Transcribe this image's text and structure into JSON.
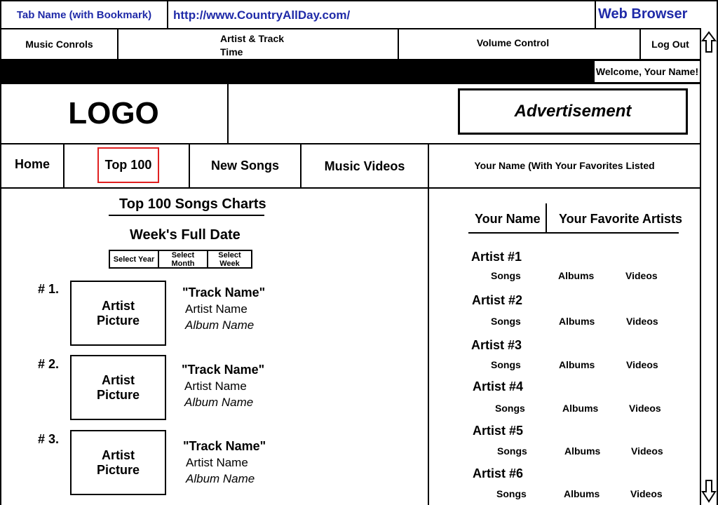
{
  "browser": {
    "tab_name": "Tab Name (with Bookmark)",
    "url": "http://www.CountryAllDay.com/",
    "title": "Web Browser"
  },
  "player": {
    "music_controls": "Music Conrols",
    "artist_track_line1": "Artist & Track",
    "artist_track_line2": "Time",
    "volume_control": "Volume Control",
    "log_out": "Log Out"
  },
  "welcome": "Welcome, Your Name!",
  "header": {
    "logo": "LOGO",
    "advertisement": "Advertisement"
  },
  "nav": {
    "home": "Home",
    "top100": "Top 100",
    "new_songs": "New Songs",
    "music_videos": "Music Videos",
    "favorites": "Your Name (With Your Favorites Listed"
  },
  "charts": {
    "title": "Top 100 Songs Charts",
    "date": "Week's Full Date",
    "select_year": "Select Year",
    "select_month": "Select Month",
    "select_week": "Select Week",
    "entries": [
      {
        "rank": "# 1.",
        "pic_line1": "Artist",
        "pic_line2": "Picture",
        "track": "\"Track Name\"",
        "artist": "Artist Name",
        "album": "Album Name"
      },
      {
        "rank": "# 2.",
        "pic_line1": "Artist",
        "pic_line2": "Picture",
        "track": "\"Track Name\"",
        "artist": "Artist Name",
        "album": "Album Name"
      },
      {
        "rank": "# 3.",
        "pic_line1": "Artist",
        "pic_line2": "Picture",
        "track": "\"Track Name\"",
        "artist": "Artist Name",
        "album": "Album Name"
      }
    ]
  },
  "favorites": {
    "your_name": "Your Name",
    "your_favorite_artists": "Your Favorite Artists",
    "artists": [
      {
        "name": "Artist #1",
        "songs": "Songs",
        "albums": "Albums",
        "videos": "Videos"
      },
      {
        "name": "Artist #2",
        "songs": "Songs",
        "albums": "Albums",
        "videos": "Videos"
      },
      {
        "name": "Artist #3",
        "songs": "Songs",
        "albums": "Albums",
        "videos": "Videos"
      },
      {
        "name": "Artist #4",
        "songs": "Songs",
        "albums": "Albums",
        "videos": "Videos"
      },
      {
        "name": "Artist #5",
        "songs": "Songs",
        "albums": "Albums",
        "videos": "Videos"
      },
      {
        "name": "Artist #6",
        "songs": "Songs",
        "albums": "Albums",
        "videos": "Videos"
      }
    ]
  },
  "colors": {
    "browser_text": "#1f2aa8",
    "highlight_border": "#e02020"
  }
}
